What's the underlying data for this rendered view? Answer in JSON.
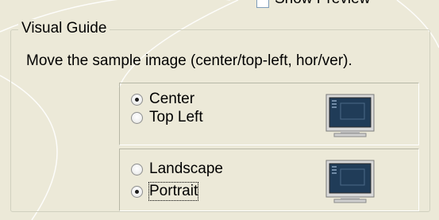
{
  "top": {
    "partial_checkbox_label": "Show Preview"
  },
  "groupbox": {
    "title": "Visual Guide",
    "description": "Move the sample image (center/top-left, hor/ver).",
    "position_group": {
      "options": [
        {
          "label": "Center",
          "checked": true
        },
        {
          "label": "Top Left",
          "checked": false
        }
      ],
      "preview_icon": "monitor-preview-icon"
    },
    "orientation_group": {
      "options": [
        {
          "label": "Landscape",
          "checked": false
        },
        {
          "label": "Portrait",
          "checked": true
        }
      ],
      "preview_icon": "monitor-preview-icon"
    }
  },
  "colors": {
    "dialog_background": "#ece9d8",
    "monitor_screen": "#203c58",
    "monitor_bezel": "#dcdcdc"
  }
}
